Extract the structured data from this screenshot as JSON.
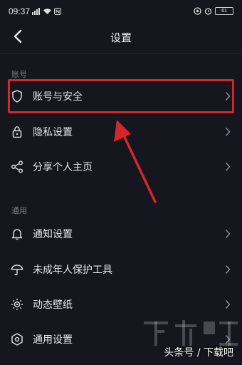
{
  "status_bar": {
    "time": "09:37",
    "battery": "61"
  },
  "header": {
    "title": "设置"
  },
  "sections": [
    {
      "label": "账号",
      "items": [
        {
          "label": "账号与安全",
          "icon": "shield-icon"
        },
        {
          "label": "隐私设置",
          "icon": "lock-icon"
        },
        {
          "label": "分享个人主页",
          "icon": "share-icon"
        }
      ]
    },
    {
      "label": "通用",
      "items": [
        {
          "label": "通知设置",
          "icon": "bell-icon"
        },
        {
          "label": "未成年人保护工具",
          "icon": "umbrella-icon"
        },
        {
          "label": "动态壁纸",
          "icon": "wallpaper-icon"
        },
        {
          "label": "通用设置",
          "icon": "hexagon-gear-icon"
        }
      ]
    }
  ],
  "watermark": {
    "caption": "头条号 / 下载吧",
    "logo": "下载吧"
  },
  "colors": {
    "background": "#16161e",
    "highlight": "#d4262d"
  }
}
